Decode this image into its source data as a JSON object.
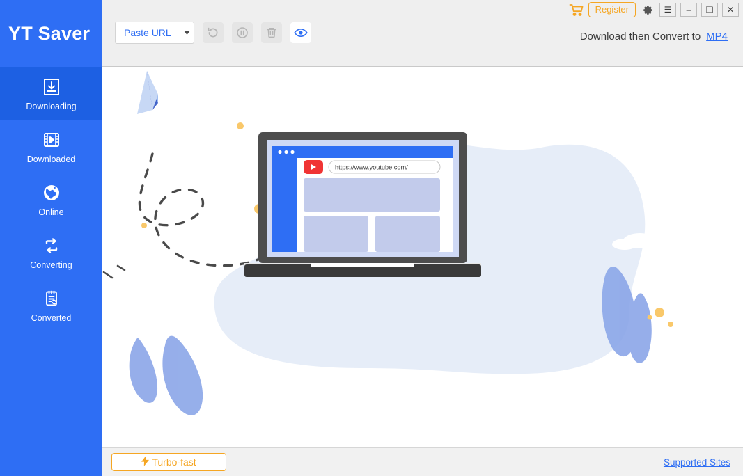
{
  "app": {
    "name": "YT Saver"
  },
  "titlebar": {
    "cart_icon": "shopping-cart-icon",
    "register_label": "Register",
    "gear_icon": "gear-icon",
    "menu_icon": "hamburger-menu-icon",
    "minimize_icon": "minimize-icon",
    "maximize_icon": "maximize-icon",
    "close_icon": "close-icon",
    "minimize_glyph": "–",
    "maximize_glyph": "❑",
    "close_glyph": "✕",
    "menu_glyph": "☰"
  },
  "toolbar": {
    "paste_label": "Paste URL",
    "caret_glyph": "▾",
    "restart_icon": "restart-icon",
    "pause_icon": "pause-icon",
    "delete_icon": "trash-icon",
    "preview_icon": "eye-icon"
  },
  "convert": {
    "prefix": "Download then Convert to",
    "format": "MP4"
  },
  "sidebar": {
    "items": [
      {
        "label": "Downloading",
        "icon": "download-box-icon",
        "active": true
      },
      {
        "label": "Downloaded",
        "icon": "film-play-icon",
        "active": false
      },
      {
        "label": "Online",
        "icon": "globe-icon",
        "active": false
      },
      {
        "label": "Converting",
        "icon": "loop-arrows-icon",
        "active": false
      },
      {
        "label": "Converted",
        "icon": "document-sync-icon",
        "active": false
      }
    ]
  },
  "illustration": {
    "browser_url": "https://www.youtube.com/",
    "youtube_icon": "youtube-play-icon",
    "paper_plane_icon": "paper-plane-icon",
    "laptop_icon": "laptop-icon"
  },
  "statusbar": {
    "turbo_label": "Turbo-fast",
    "turbo_icon": "lightning-bolt-icon",
    "turbo_glyph": "⚡",
    "supported_sites_label": "Supported Sites"
  },
  "colors": {
    "brand_blue": "#2e6ef4",
    "active_blue": "#1d60e3",
    "accent_orange": "#f5a623",
    "header_gray": "#efefef",
    "youtube_red": "#f03434",
    "blob_blue": "#e6edf8",
    "leaf_blue": "#8ba6e8"
  }
}
